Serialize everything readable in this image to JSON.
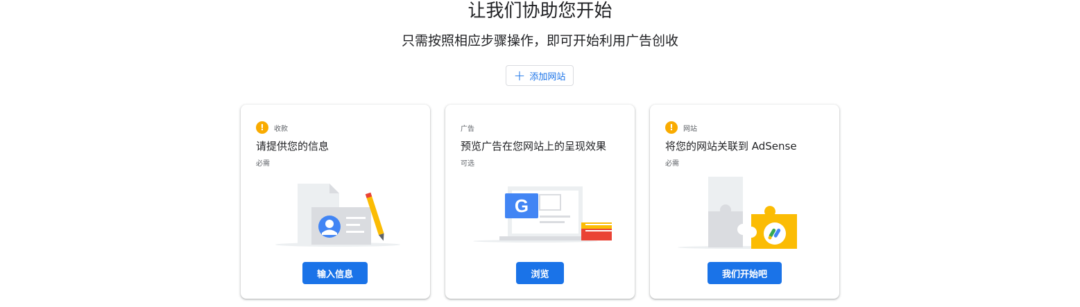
{
  "header": {
    "title": "让我们协助您开始",
    "subtitle": "只需按照相应步骤操作，即可开始利用广告创收"
  },
  "add_site": {
    "label": "添加网站",
    "icon": "plus-icon"
  },
  "cards": [
    {
      "category": "收款",
      "warning": true,
      "title": "请提供您的信息",
      "requirement": "必需",
      "button": "输入信息",
      "illustration": "payment-info-illustration"
    },
    {
      "category": "广告",
      "warning": false,
      "title": "预览广告在您网站上的呈现效果",
      "requirement": "可选",
      "button": "浏览",
      "illustration": "ad-preview-illustration"
    },
    {
      "category": "网站",
      "warning": true,
      "title": "将您的网站关联到 AdSense",
      "requirement": "必需",
      "button": "我们开始吧",
      "illustration": "site-connect-illustration"
    }
  ],
  "colors": {
    "primary": "#1a73e8",
    "warning": "#f9ab00",
    "text": "#202124",
    "secondary_text": "#5f6368"
  }
}
